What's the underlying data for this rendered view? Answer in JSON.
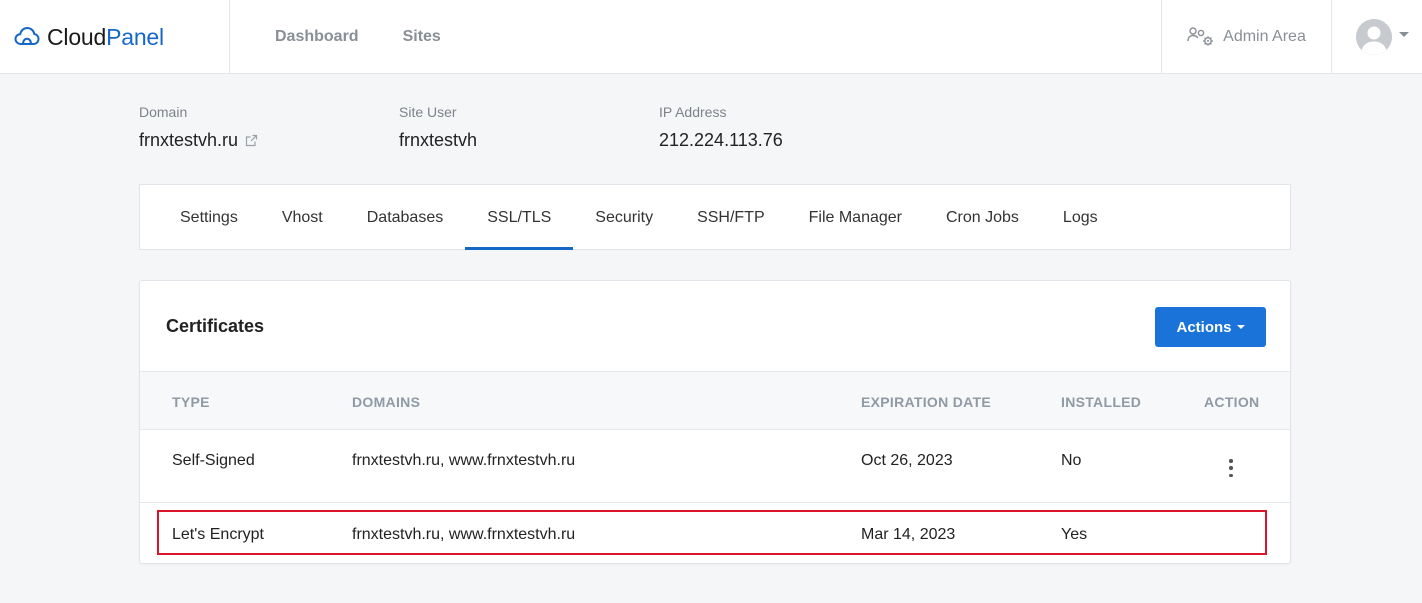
{
  "brand": {
    "name_part1": "Cloud",
    "name_part2": "Panel"
  },
  "nav": {
    "dashboard": "Dashboard",
    "sites": "Sites"
  },
  "admin": {
    "label": "Admin Area"
  },
  "site": {
    "domain_label": "Domain",
    "domain_value": "frnxtestvh.ru",
    "user_label": "Site User",
    "user_value": "frnxtestvh",
    "ip_label": "IP Address",
    "ip_value": "212.224.113.76"
  },
  "tabs": [
    {
      "label": "Settings"
    },
    {
      "label": "Vhost"
    },
    {
      "label": "Databases"
    },
    {
      "label": "SSL/TLS",
      "active": true
    },
    {
      "label": "Security"
    },
    {
      "label": "SSH/FTP"
    },
    {
      "label": "File Manager"
    },
    {
      "label": "Cron Jobs"
    },
    {
      "label": "Logs"
    }
  ],
  "certificates": {
    "title": "Certificates",
    "actions_label": "Actions",
    "columns": {
      "type": "TYPE",
      "domains": "DOMAINS",
      "expiration": "EXPIRATION DATE",
      "installed": "INSTALLED",
      "action": "ACTION"
    },
    "rows": [
      {
        "type": "Self-Signed",
        "domains": "frnxtestvh.ru, www.frnxtestvh.ru",
        "expiration": "Oct 26, 2023",
        "installed": "No"
      },
      {
        "type": "Let's Encrypt",
        "domains": "frnxtestvh.ru, www.frnxtestvh.ru",
        "expiration": "Mar 14, 2023",
        "installed": "Yes"
      }
    ]
  },
  "colors": {
    "accent": "#1668c6",
    "button": "#1a73d9",
    "highlight": "#d9142b"
  }
}
